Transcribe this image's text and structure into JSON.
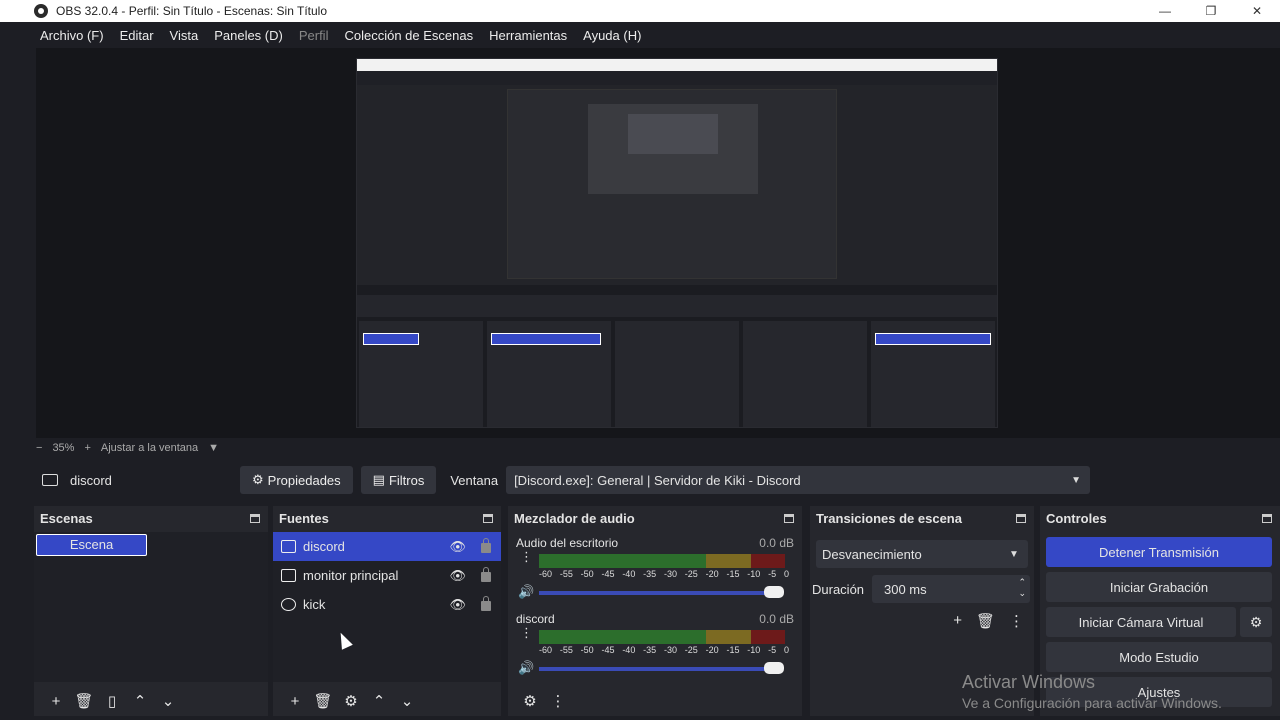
{
  "window": {
    "title": "OBS 32.0.4 - Perfil: Sin Título - Escenas: Sin Título",
    "minimize": "—",
    "maximize": "❐",
    "close": "✕"
  },
  "menu": {
    "items": [
      "Archivo (F)",
      "Editar",
      "Vista",
      "Paneles (D)",
      "Perfil",
      "Colección de Escenas",
      "Herramientas",
      "Ayuda (H)"
    ]
  },
  "zoom": {
    "minus": "−",
    "value": "35%",
    "plus": "+",
    "fit_label": "Ajustar a la ventana",
    "caret": "▼"
  },
  "context": {
    "source_name": "discord",
    "properties_label": "Propiedades",
    "filters_label": "Filtros",
    "window_label": "Ventana",
    "window_value": "[Discord.exe]: General | Servidor de Kiki - Discord",
    "caret": "▼"
  },
  "scenes": {
    "title": "Escenas",
    "items": [
      "Escena"
    ],
    "footer_icons": [
      "+",
      "🗑",
      "▯",
      "⌃",
      "⌄"
    ]
  },
  "sources": {
    "title": "Fuentes",
    "items": [
      {
        "name": "discord",
        "selected": true
      },
      {
        "name": "monitor principal",
        "selected": false
      },
      {
        "name": "kick",
        "selected": false
      }
    ],
    "eye": "👁",
    "footer_icons": [
      "+",
      "🗑",
      "⚙",
      "⌃",
      "⌄"
    ]
  },
  "mixer": {
    "title": "Mezclador de audio",
    "channels": [
      {
        "name": "Audio del escritorio",
        "db": "0.0 dB"
      },
      {
        "name": "discord",
        "db": "0.0 dB"
      }
    ],
    "scale": [
      "-60",
      "-55",
      "-50",
      "-45",
      "-40",
      "-35",
      "-30",
      "-25",
      "-20",
      "-15",
      "-10",
      "-5",
      "0"
    ],
    "dots": "⋮",
    "vol": "🔊",
    "footer_icons": [
      "⚙",
      "⋮"
    ]
  },
  "transitions": {
    "title": "Transiciones de escena",
    "selected": "Desvanecimiento",
    "duration_label": "Duración",
    "duration_value": "300 ms",
    "tools": [
      "+",
      "🗑",
      "⋮"
    ],
    "up": "⌃",
    "down": "⌄"
  },
  "controls": {
    "title": "Controles",
    "stop_stream": "Detener Transmisión",
    "start_record": "Iniciar Grabación",
    "virtual_cam": "Iniciar Cámara Virtual",
    "studio_mode": "Modo Estudio",
    "settings": "Ajustes",
    "gear": "⚙"
  },
  "watermark": {
    "line1": "Activar Windows",
    "line2": "Ve a Configuración para activar Windows."
  },
  "colors": {
    "accent": "#3548c6",
    "background": "#1d1e24",
    "dock": "#26272d"
  }
}
